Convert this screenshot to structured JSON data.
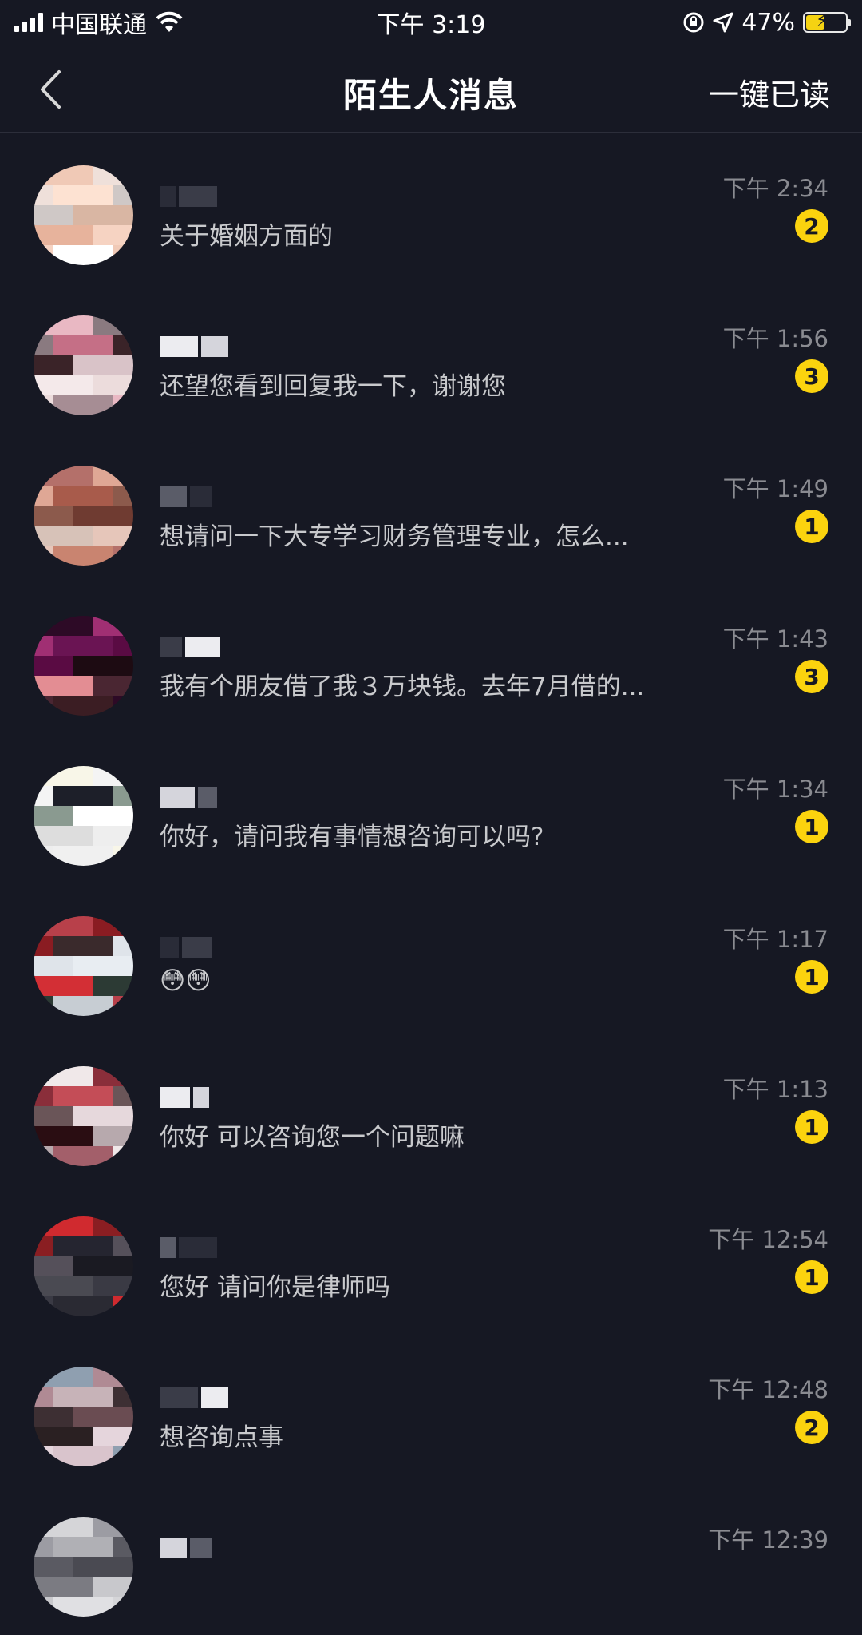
{
  "status_bar": {
    "carrier": "中国联通",
    "time": "下午 3:19",
    "battery": "47%",
    "battery_level": 0.47
  },
  "header": {
    "title": "陌生人消息",
    "action": "一键已读",
    "back_icon": "chevron-left-icon"
  },
  "conversations": [
    {
      "preview": "关于婚姻方面的",
      "time": "下午 2:34",
      "unread": "2"
    },
    {
      "preview": "还望您看到回复我一下，谢谢您",
      "time": "下午 1:56",
      "unread": "3"
    },
    {
      "preview": "想请问一下大专学习财务管理专业，怎么...",
      "time": "下午 1:49",
      "unread": "1"
    },
    {
      "preview": "我有个朋友借了我３万块钱。去年7月借的...",
      "time": "下午 1:43",
      "unread": "3"
    },
    {
      "preview": "你好，请问我有事情想咨询可以吗?",
      "time": "下午 1:34",
      "unread": "1"
    },
    {
      "preview": "😳😳",
      "time": "下午 1:17",
      "unread": "1"
    },
    {
      "preview": "你好 可以咨询您一个问题嘛",
      "time": "下午 1:13",
      "unread": "1"
    },
    {
      "preview": "您好  请问你是律师吗",
      "time": "下午 12:54",
      "unread": "1"
    },
    {
      "preview": "想咨询点事",
      "time": "下午 12:48",
      "unread": "2"
    },
    {
      "preview": "",
      "time": "下午 12:39",
      "unread": ""
    }
  ]
}
